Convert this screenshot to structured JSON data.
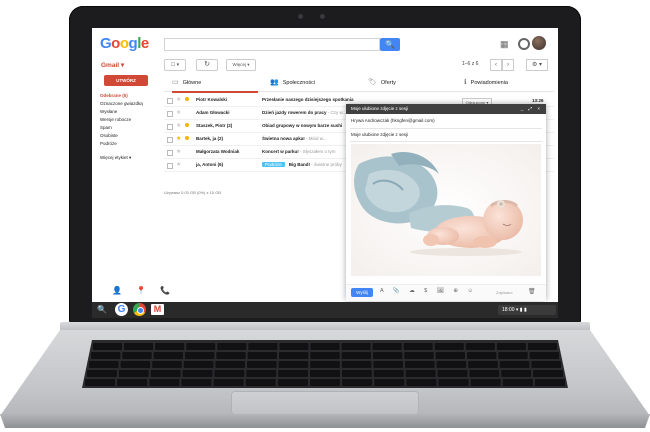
{
  "topbar": {
    "logo_letters": [
      {
        "ch": "G",
        "color": "#4285f4"
      },
      {
        "ch": "o",
        "color": "#ea4335"
      },
      {
        "ch": "o",
        "color": "#fbbc05"
      },
      {
        "ch": "g",
        "color": "#4285f4"
      },
      {
        "ch": "l",
        "color": "#34a853"
      },
      {
        "ch": "e",
        "color": "#ea4335"
      }
    ],
    "search_button_icon": "search-icon",
    "search_button_glyph": "🔍"
  },
  "app_label": "Gmail ▾",
  "toolbar": {
    "select_label": "☐ ▾",
    "refresh_label": "↻",
    "more_label": "Więcej ▾",
    "pagination": "1–6 z 6",
    "prev": "‹",
    "next": "›",
    "settings": "⚙ ▾"
  },
  "compose_label": "UTWÓRZ",
  "sidebar": {
    "items": [
      {
        "label": "Odebrane (5)",
        "active": true,
        "count": ""
      },
      {
        "label": "Oznaczone gwiazdką",
        "active": false,
        "count": ""
      },
      {
        "label": "Wysłane",
        "active": false,
        "count": ""
      },
      {
        "label": "Wersje robocze",
        "active": false,
        "count": ""
      },
      {
        "label": "Spam",
        "active": false,
        "count": ""
      },
      {
        "label": "Osobiste",
        "active": false,
        "count": "■"
      },
      {
        "label": "Podróże",
        "active": false,
        "count": "■"
      },
      {
        "label": "Więcej etykiet ▾",
        "active": false,
        "count": ""
      }
    ],
    "bottom_icons": "👤 📍 📞"
  },
  "tabs": [
    {
      "label": "Główne",
      "icon": "▭",
      "active": true
    },
    {
      "label": "Społeczności",
      "icon": "👥",
      "active": false
    },
    {
      "label": "Oferty",
      "icon": "🏷",
      "active": false
    },
    {
      "label": "Powiadomienia",
      "icon": "ℹ",
      "active": false
    }
  ],
  "rows": [
    {
      "sender": "Piotr Kowalski",
      "subject": "Przesłanie naszego dzisiejszego spotkania",
      "snippet": "",
      "tag": "",
      "starred": false,
      "imp": "#f4b400"
    },
    {
      "sender": "Adam Głowacki",
      "subject": "Dzień jazdy rowerem do pracy",
      "snippet": " - Czy w...",
      "tag": "",
      "starred": false,
      "imp": ""
    },
    {
      "sender": "Staszek, Piotr (2)",
      "subject": "Obiad grupowy w nowym barze sushi",
      "snippet": "",
      "tag": "",
      "starred": false,
      "imp": "#f4b400"
    },
    {
      "sender": "Bartek, ja (2)",
      "subject": "Świetna nowa apka!",
      "snippet": " - Miód w...",
      "tag": "",
      "starred": true,
      "imp": "#f4b400"
    },
    {
      "sender": "Małgorzata Wodniak",
      "subject": "Koncert w parku!",
      "snippet": " - Słyszałem o tym",
      "tag": "",
      "starred": false,
      "imp": ""
    },
    {
      "sender": "ja, Antoni (6)",
      "subject": "Big Band!",
      "snippet": " - świetne próby",
      "tag": "Podróże",
      "starred": false,
      "imp": ""
    }
  ],
  "storage_text": "Używasz 0,03 GB (0%) z 15 GB",
  "status_dropdown": "Odrzucone ▾",
  "row_time": "13:26",
  "compose_window": {
    "title": "Moje ulubione zdjęcie z sesji",
    "controls": "_ ⤢ ×",
    "to": "Hrywa Androwczak (hkngfen@gmail.com)",
    "subject": "Moje ulubione zdjęcie z sesji",
    "send_label": "Wyślij",
    "footer_icons": "A 📎 ☁ $ 🖼 ⊕ ☺",
    "saved_text": "Zapisano",
    "trash": "🗑"
  },
  "shelf": {
    "search_glyph": "🔍",
    "g_letter": "G",
    "gmail_letter": "M",
    "status_text": "18:00 ▾ ▮ ▮"
  },
  "colors": {
    "accent": "#d14836",
    "blue": "#4285f4",
    "dark": "#1c1c1e"
  }
}
